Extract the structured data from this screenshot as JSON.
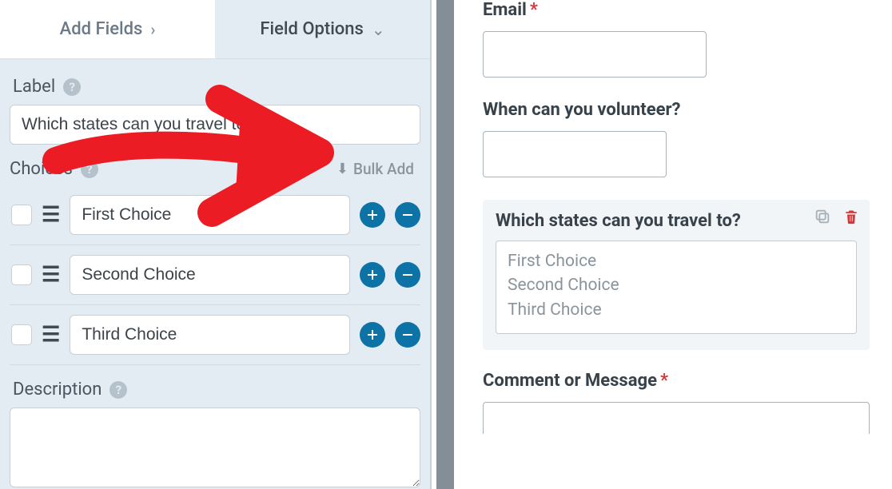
{
  "tabs": {
    "add_fields": "Add Fields",
    "field_options": "Field Options"
  },
  "options": {
    "label_label": "Label",
    "label_value": "Which states can you travel to?",
    "choices_label": "Choices",
    "bulk_add": "Bulk Add",
    "choices": [
      "First Choice",
      "Second Choice",
      "Third Choice"
    ],
    "description_label": "Description",
    "description_value": ""
  },
  "preview": {
    "email_label": "Email",
    "volunteer_label": "When can you volunteer?",
    "states_label": "Which states can you travel to?",
    "states_options": [
      "First Choice",
      "Second Choice",
      "Third Choice"
    ],
    "comment_label": "Comment or Message"
  },
  "icons": {
    "help": "?",
    "required": "*"
  }
}
